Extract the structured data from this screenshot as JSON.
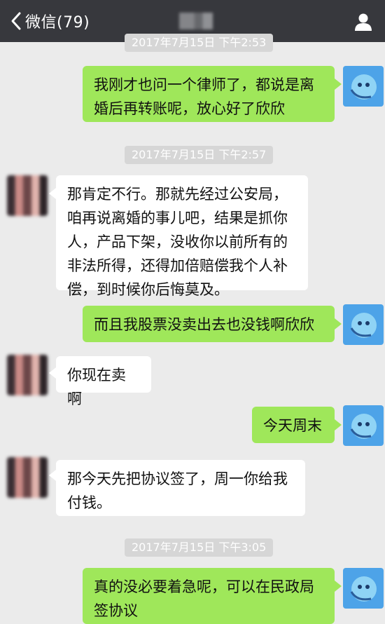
{
  "header": {
    "back_label": "微信(79)",
    "title_blurred": true
  },
  "timestamps": [
    "2017年7月15日 下午2:53",
    "2017年7月15日 下午2:57",
    "2017年7月15日 下午3:05"
  ],
  "messages": [
    {
      "from": "me",
      "text": "我刚才也问一个律师了，都说是离\n婚后再转账呢，放心好了欣欣"
    },
    {
      "from": "other",
      "text": "那肯定不行。那就先经过公安局，\n咱再说离婚的事儿吧，结果是抓你\n人，产品下架，没收你以前所有的\n非法所得，还得加倍赔偿我个人补\n偿，到时候你后悔莫及。"
    },
    {
      "from": "me",
      "text": "而且我股票没卖出去也没钱啊欣欣"
    },
    {
      "from": "other",
      "text": "你现在卖啊"
    },
    {
      "from": "me",
      "text": "今天周末"
    },
    {
      "from": "other",
      "text": "那今天先把协议签了，周一你给我\n付钱。"
    },
    {
      "from": "me",
      "text": "真的没必要着急呢，可以在民政局\n签协议"
    }
  ],
  "colors": {
    "topbar": "#37383d",
    "background": "#ebebeb",
    "bubble_out": "#9fe75a",
    "bubble_in": "#ffffff",
    "timestamp_bg": "#d6d6d6"
  }
}
